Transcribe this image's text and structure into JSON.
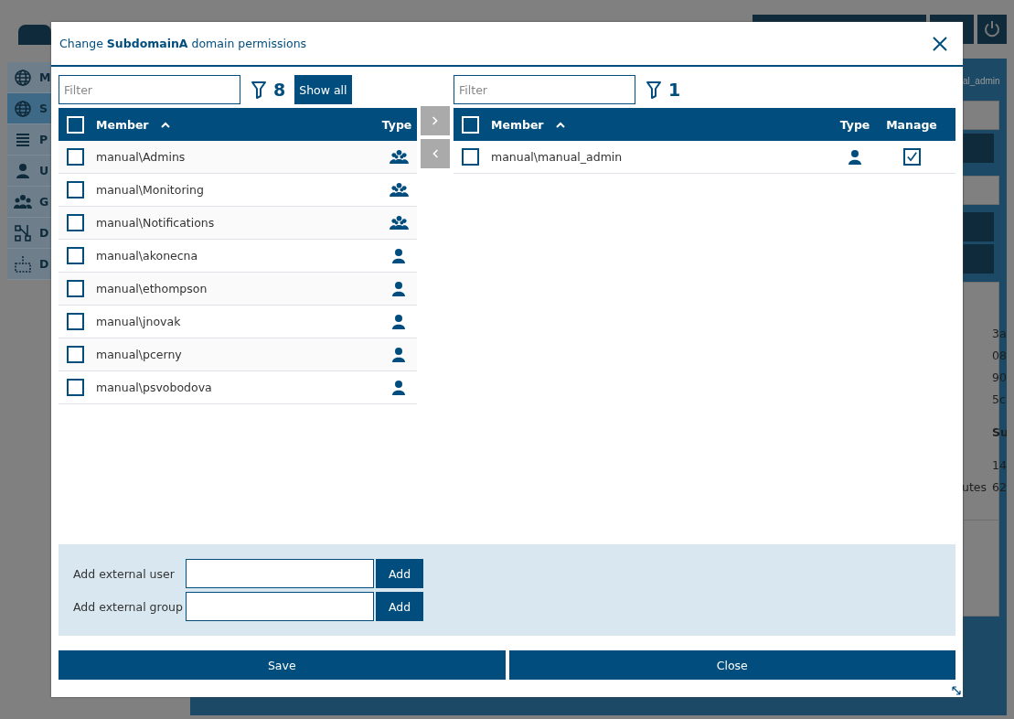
{
  "background": {
    "sidebar_items": [
      {
        "label": "M",
        "kind": "globe",
        "selected": false
      },
      {
        "label": "S",
        "kind": "globe",
        "selected": true
      },
      {
        "label": "P",
        "kind": "list",
        "selected": false
      },
      {
        "label": "U",
        "kind": "user",
        "selected": false
      },
      {
        "label": "G",
        "kind": "group",
        "selected": false
      },
      {
        "label": "D",
        "kind": "diagram",
        "selected": false
      },
      {
        "label": "D",
        "kind": "box",
        "selected": false
      }
    ],
    "user_label": "al_admin",
    "panel_rows": [
      {
        "kind": "value",
        "text": "3a"
      },
      {
        "kind": "value",
        "text": "08"
      },
      {
        "kind": "value",
        "text": "90"
      },
      {
        "kind": "value",
        "text": "5c"
      },
      {
        "kind": "heading",
        "text": "Su"
      },
      {
        "kind": "value",
        "text": "14"
      },
      {
        "kind": "pair",
        "label": "utes",
        "text": "62"
      }
    ]
  },
  "dialog": {
    "title": "Change **SubdomainA** domain permissions",
    "left": {
      "filter": {
        "placeholder": "Filter"
      },
      "count": "8",
      "show_all": "Show all",
      "select_all": false,
      "columns": {
        "member": "Member",
        "type": "Type"
      },
      "rows": [
        {
          "name": "manual\\Admins",
          "kind": "group",
          "checked": false
        },
        {
          "name": "manual\\Monitoring",
          "kind": "group",
          "checked": false
        },
        {
          "name": "manual\\Notifications",
          "kind": "group",
          "checked": false
        },
        {
          "name": "manual\\akonecna",
          "kind": "user",
          "checked": false
        },
        {
          "name": "manual\\ethompson",
          "kind": "user",
          "checked": false
        },
        {
          "name": "manual\\jnovak",
          "kind": "user",
          "checked": false
        },
        {
          "name": "manual\\pcerny",
          "kind": "user",
          "checked": false
        },
        {
          "name": "manual\\psvobodova",
          "kind": "user",
          "checked": false
        }
      ]
    },
    "right": {
      "filter": {
        "placeholder": "Filter"
      },
      "count": "1",
      "select_all": false,
      "columns": {
        "member": "Member",
        "type": "Type",
        "manage": "Manage"
      },
      "rows": [
        {
          "name": "manual\\manual_admin",
          "kind": "user",
          "checked": false,
          "manage": true
        }
      ]
    },
    "external": [
      {
        "label": "Add external user",
        "button": "Add"
      },
      {
        "label": "Add external group",
        "button": "Add"
      }
    ],
    "buttons": [
      "Save",
      "Close"
    ]
  }
}
